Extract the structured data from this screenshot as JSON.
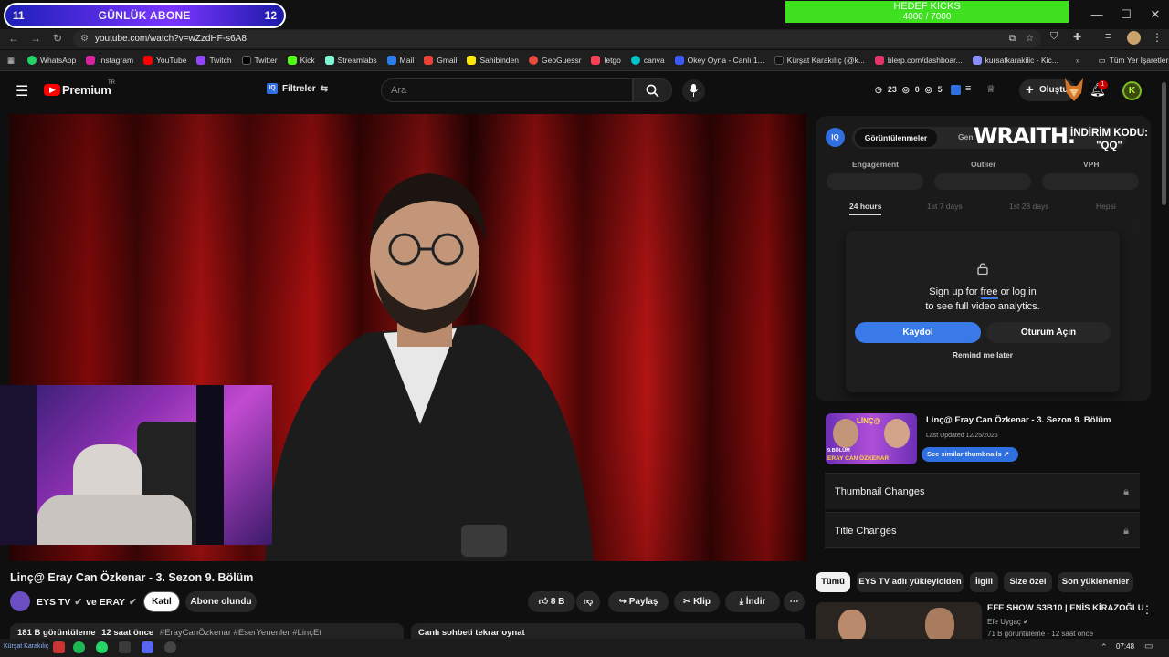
{
  "overlay": {
    "counter_left": "11",
    "counter_title": "GÜNLÜK ABONE",
    "counter_right": "12",
    "kick_goal_title": "HEDEF KICKS",
    "kick_goal_value": "4000 / 7000",
    "sponsor": "WRAITH.",
    "promo_line1": "İNDİRİM KODU:",
    "promo_line2": "\"QQ\""
  },
  "browser": {
    "url": "youtube.com/watch?v=wZzdHF-s6A8",
    "bookmarks": [
      "WhatsApp",
      "Instagram",
      "YouTube",
      "Twitch",
      "Twitter",
      "Kick",
      "Streamlabs",
      "Mail",
      "Gmail",
      "Sahibinden",
      "GeoGuessr",
      "letgo",
      "canva",
      "Okey Oyna - Canlı 1...",
      "Kürşat Karakılıç (@k...",
      "blerp.com/dashboar...",
      "kursatkarakilic - Kic..."
    ],
    "all_bookmarks": "Tüm Yer İşaretleri"
  },
  "youtube": {
    "logo": "Premium",
    "logo_badge": "TR",
    "filters": "Filtreler",
    "search_placeholder": "Ara",
    "stats": [
      "23",
      "0",
      "5"
    ],
    "create": "Oluştur",
    "notif_count": "1",
    "avatar_letter": "K"
  },
  "video": {
    "title": "Linç@ Eray Can Özkenar - 3. Sezon 9. Bölüm",
    "channel": "EYS TV",
    "collab": "ve ERAY",
    "join": "Katıl",
    "subscribed": "Abone olundu",
    "likes": "8 B",
    "share": "Paylaş",
    "clip": "Klip",
    "download": "İndir",
    "views": "181 B görüntüleme",
    "time_ago": "12 saat önce",
    "tags": "#ErayCanÖzkenar #EserYenenler #LinçEt",
    "chat_replay": "Canlı sohbeti tekrar oynat"
  },
  "iq_panel": {
    "logo": "IQ",
    "tab_active": "Görüntülenmeler",
    "tab_2": "Gen",
    "metrics": [
      "Engagement",
      "Outlier",
      "VPH"
    ],
    "ranges": [
      "24 hours",
      "1st 7 days",
      "1st 28 days",
      "Hepsi"
    ],
    "signup_line1_a": "Sign up for ",
    "signup_free": "free",
    "signup_line1_b": " or log in",
    "signup_line2": "to see full video analytics.",
    "signup_btn": "Kaydol",
    "login_btn": "Oturum Açın",
    "remind": "Remind me later",
    "thumb_title": "Linç@ Eray Can Özkenar - 3. Sezon 9. Bölüm",
    "thumb_updated": "Last Updated 12/25/2025",
    "similar_btn": "See similar thumbnails",
    "thumb_caption_top": "LİNÇ@",
    "thumb_caption_bottom": "ERAY CAN ÖZKENAR",
    "thumb_caption_episode": "9.BÖLÜM",
    "thumbnail_changes": "Thumbnail Changes",
    "title_changes": "Title Changes"
  },
  "related": {
    "chips": [
      "Tümü",
      "EYS TV adlı yükleyiciden",
      "İlgili",
      "Size özel",
      "Son yüklenenler"
    ],
    "item_title": "EFE SHOW S3B10 | ENİS KİRAZOĞLU",
    "item_channel": "Efe Uygaç",
    "item_meta": "71 B görüntüleme · 12 saat önce"
  },
  "taskbar": {
    "time": "07:48",
    "label": "Kürşat Karakılıç"
  }
}
